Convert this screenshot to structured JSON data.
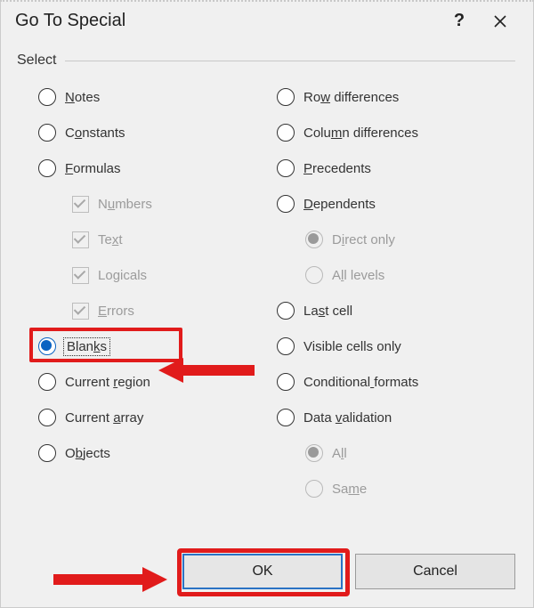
{
  "titlebar": {
    "title": "Go To Special",
    "help": "?",
    "close": "×"
  },
  "group_label": "Select",
  "left": {
    "notes": "Notes",
    "constants": "Constants",
    "formulas": "Formulas",
    "numbers": "Numbers",
    "text": "Text",
    "logicals": "Logicals",
    "errors": "Errors",
    "blanks": "Blanks",
    "current_region": "Current region",
    "current_array": "Current array",
    "objects": "Objects"
  },
  "right": {
    "row_diff": "Row differences",
    "col_diff": "Column differences",
    "precedents": "Precedents",
    "dependents": "Dependents",
    "direct_only": "Direct only",
    "all_levels": "All levels",
    "last_cell": "Last cell",
    "visible_cells": "Visible cells only",
    "conditional": "Conditional formats",
    "data_validation": "Data validation",
    "all": "All",
    "same": "Same"
  },
  "underline": {
    "notes": 0,
    "constants": 1,
    "formulas": 0,
    "numbers": 1,
    "text": 2,
    "logicals": 2,
    "errors": 0,
    "blanks": 4,
    "current_region": 8,
    "current_array": 8,
    "objects": 1,
    "row_diff": 2,
    "col_diff": 4,
    "precedents": 0,
    "dependents": 0,
    "direct_only": 1,
    "all_levels": 1,
    "last_cell": 2,
    "visible_cells": 18,
    "conditional": 11,
    "data_validation": 5,
    "all": 1,
    "same": 2
  },
  "buttons": {
    "ok": "OK",
    "cancel": "Cancel"
  },
  "selected": "blanks"
}
